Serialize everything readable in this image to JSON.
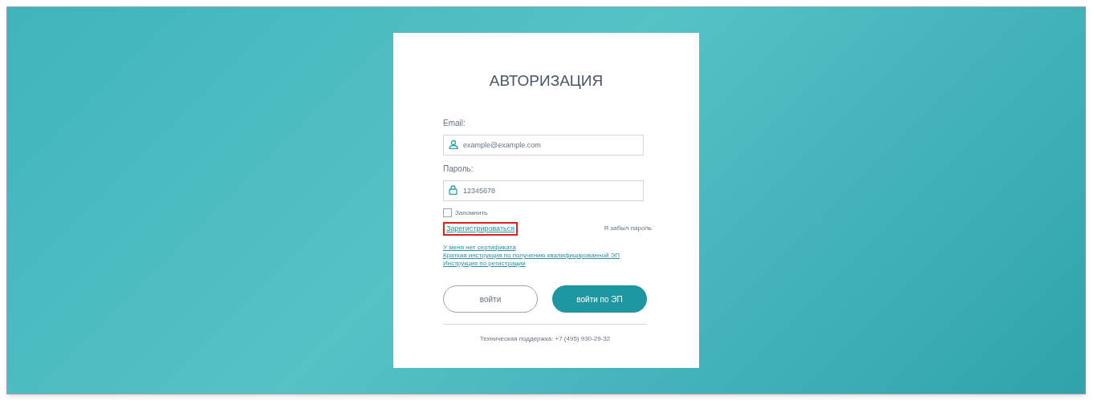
{
  "title": "АВТОРИЗАЦИЯ",
  "email": {
    "label": "Email:",
    "placeholder": "example@example.com"
  },
  "password": {
    "label": "Пароль:",
    "placeholder": "12345678"
  },
  "remember": {
    "label": "Запомнить",
    "checked": false
  },
  "register_link": {
    "label": "Зарегистрироваться",
    "highlighted": true
  },
  "forgot_link": "Я забыл пароль",
  "links": [
    "У меня нет сертификата",
    "Краткая инструкция по получению квалифицированной ЭП",
    "Инструкция по регистрации"
  ],
  "buttons": [
    {
      "label": "войти",
      "kind": "outline"
    },
    {
      "label": "войти по ЭП",
      "kind": "filled"
    }
  ],
  "support": "Техническая поддержка: +7 (495) 930-29-32"
}
